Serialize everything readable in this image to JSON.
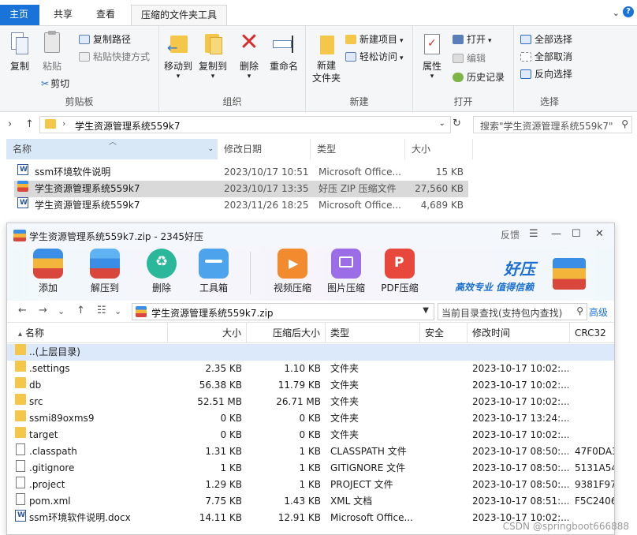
{
  "explorer": {
    "tabs": [
      {
        "label": "主页"
      },
      {
        "label": "共享"
      },
      {
        "label": "查看"
      },
      {
        "label": "压缩的文件夹工具"
      }
    ],
    "ribbon": {
      "clipboard": {
        "group_label": "剪贴板",
        "copy_label": "复制",
        "paste_label": "粘贴",
        "copy_path_label": "复制路径",
        "paste_shortcut_label": "粘贴快捷方式",
        "cut_label": "剪切"
      },
      "organize": {
        "group_label": "组织",
        "move_to_label": "移动到",
        "copy_to_label": "复制到",
        "delete_label": "删除",
        "rename_label": "重命名"
      },
      "new": {
        "group_label": "新建",
        "new_folder_label": "新建\n文件夹",
        "new_item_label": "新建项目",
        "easy_access_label": "轻松访问"
      },
      "open": {
        "group_label": "打开",
        "properties_label": "属性",
        "open_label": "打开",
        "edit_label": "编辑",
        "history_label": "历史记录"
      },
      "select": {
        "group_label": "选择",
        "select_all_label": "全部选择",
        "select_none_label": "全部取消",
        "invert_label": "反向选择"
      }
    },
    "address": {
      "path": "学生资源管理系统559k7",
      "search_placeholder": "搜索\"学生资源管理系统559k7\""
    },
    "columns": {
      "name": "名称",
      "modified": "修改日期",
      "type": "类型",
      "size": "大小"
    },
    "files": [
      {
        "name": "ssm环境软件说明",
        "modified": "2023/10/17 10:51",
        "type": "Microsoft Office...",
        "size": "15 KB",
        "icon": "word-doc-icon"
      },
      {
        "name": "学生资源管理系统559k7",
        "modified": "2023/10/17 13:35",
        "type": "好压 ZIP 压缩文件",
        "size": "27,560 KB",
        "icon": "zip-archive-icon"
      },
      {
        "name": "学生资源管理系统559k7",
        "modified": "2023/11/26 18:25",
        "type": "Microsoft Office...",
        "size": "4,689 KB",
        "icon": "word-doc-icon"
      }
    ]
  },
  "haozip": {
    "title": "学生资源管理系统559k7.zip - 2345好压",
    "feedback_label": "反馈",
    "toolbar": {
      "add_label": "添加",
      "extract_label": "解压到",
      "delete_label": "删除",
      "toolbox_label": "工具箱",
      "video_label": "视频压缩",
      "image_label": "图片压缩",
      "pdf_label": "PDF压缩"
    },
    "brand": {
      "name": "好压",
      "slogan": "高效专业  值得信赖"
    },
    "path": "学生资源管理系统559k7.zip",
    "search_placeholder": "当前目录查找(支持包内查找)",
    "advanced_label": "高级",
    "columns": {
      "name": "名称",
      "size": "大小",
      "compressed": "压缩后大小",
      "type": "类型",
      "security": "安全",
      "modified": "修改时间",
      "crc": "CRC32"
    },
    "rows": [
      {
        "name": "..(上层目录)",
        "size": "",
        "compressed": "",
        "type": "",
        "modified": "",
        "crc": "",
        "icon": "parent-folder-icon"
      },
      {
        "name": ".settings",
        "size": "2.35 KB",
        "compressed": "1.10 KB",
        "type": "文件夹",
        "modified": "2023-10-17 10:02:...",
        "crc": "",
        "icon": "folder-icon"
      },
      {
        "name": "db",
        "size": "56.38 KB",
        "compressed": "11.79 KB",
        "type": "文件夹",
        "modified": "2023-10-17 10:02:...",
        "crc": "",
        "icon": "folder-icon"
      },
      {
        "name": "src",
        "size": "52.51 MB",
        "compressed": "26.71 MB",
        "type": "文件夹",
        "modified": "2023-10-17 10:02:...",
        "crc": "",
        "icon": "folder-icon"
      },
      {
        "name": "ssmi89oxms9",
        "size": "0 KB",
        "compressed": "0 KB",
        "type": "文件夹",
        "modified": "2023-10-17 13:24:...",
        "crc": "",
        "icon": "folder-icon"
      },
      {
        "name": "target",
        "size": "0 KB",
        "compressed": "0 KB",
        "type": "文件夹",
        "modified": "2023-10-17 10:02:...",
        "crc": "",
        "icon": "folder-icon"
      },
      {
        "name": ".classpath",
        "size": "1.31 KB",
        "compressed": "1 KB",
        "type": "CLASSPATH 文件",
        "modified": "2023-10-17 08:50:...",
        "crc": "47F0DA3",
        "icon": "file-icon"
      },
      {
        "name": ".gitignore",
        "size": "1 KB",
        "compressed": "1 KB",
        "type": "GITIGNORE 文件",
        "modified": "2023-10-17 08:50:...",
        "crc": "5131A54",
        "icon": "file-icon"
      },
      {
        "name": ".project",
        "size": "1.29 KB",
        "compressed": "1 KB",
        "type": "PROJECT 文件",
        "modified": "2023-10-17 08:50:...",
        "crc": "9381F97",
        "icon": "file-icon"
      },
      {
        "name": "pom.xml",
        "size": "7.75 KB",
        "compressed": "1.43 KB",
        "type": "XML 文档",
        "modified": "2023-10-17 08:51:...",
        "crc": "F5C2406",
        "icon": "file-icon"
      },
      {
        "name": "ssm环境软件说明.docx",
        "size": "14.11 KB",
        "compressed": "12.91 KB",
        "type": "Microsoft Office...",
        "modified": "2023-10-17 10:02:...",
        "crc": "",
        "icon": "word-doc-icon"
      }
    ]
  },
  "watermark": "CSDN @springboot666888",
  "colors": {
    "accent": "#1a73d9",
    "selection": "#dbe9fa",
    "folder": "#f4c64a",
    "brand": "#1b6fd1"
  }
}
